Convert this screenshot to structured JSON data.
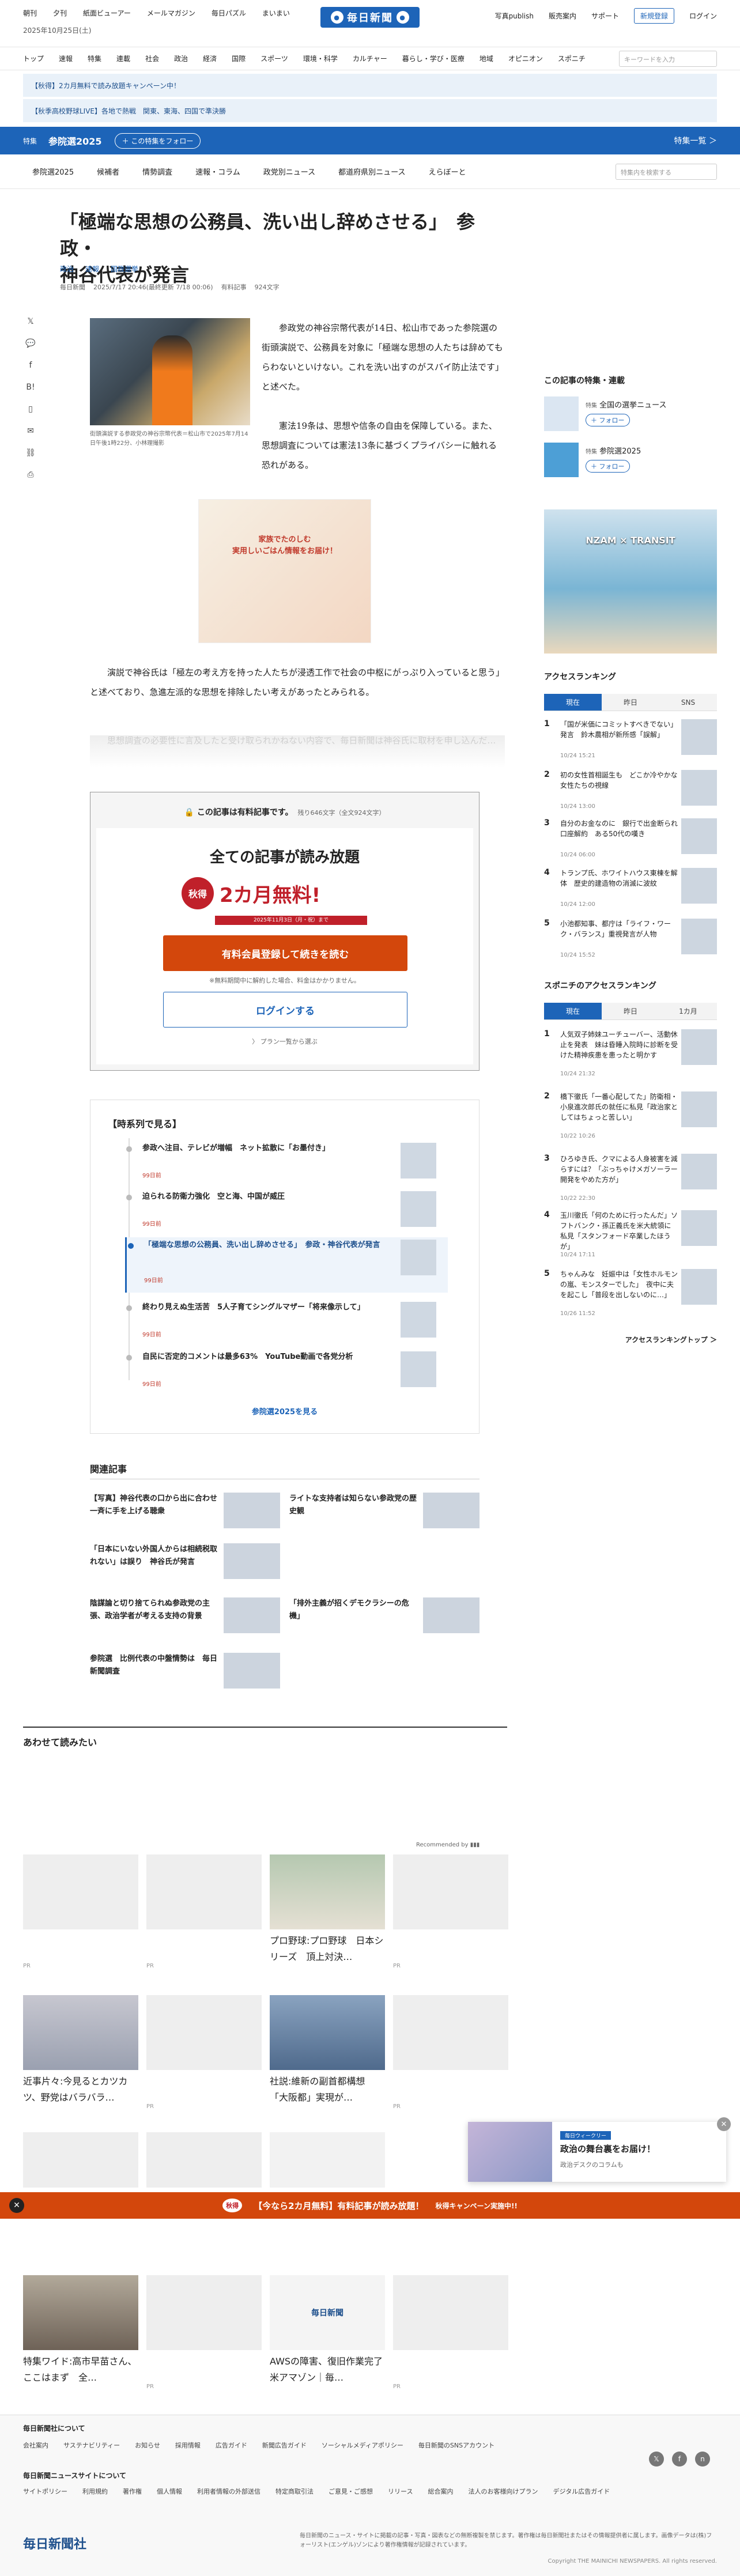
{
  "header": {
    "links": [
      "朝刊",
      "夕刊",
      "紙面ビューアー",
      "メールマガジン",
      "毎日パズル",
      "まいまい"
    ],
    "date": "2025年10月25日(土)",
    "logo": "毎日新聞",
    "right_links": [
      "写真publish",
      "販売案内",
      "サポート"
    ],
    "register_label": "新規登録",
    "login_label": "ログイン"
  },
  "catnav": {
    "items": [
      "トップ",
      "速報",
      "特集",
      "連載",
      "社会",
      "政治",
      "経済",
      "国際",
      "スポーツ",
      "環境・科学",
      "カルチャー",
      "暮らし・学び・医療",
      "地域",
      "オピニオン",
      "スポニチ"
    ],
    "search_placeholder": "キーワードを入力"
  },
  "promos": [
    "【秋得】2カ月無料で読み放題キャンペーン中！",
    "【秋季高校野球LIVE】各地で熱戦　関東、東海、四国で準決勝"
  ],
  "feature_bar": {
    "tag": "特集",
    "title": "参院選2025",
    "follow": "＋ この特集をフォロー",
    "list": "特集一覧 ＞"
  },
  "subnav": {
    "items": [
      "参院選2025",
      "候補者",
      "情勢調査",
      "速報・コラム",
      "政党別ニュース",
      "都道府県別ニュース",
      "えらぼーと"
    ],
    "search_placeholder": "特集内を検索する"
  },
  "article": {
    "title_line1": "「極端な思想の公務員、洗い出し辞めさせる」　参政・",
    "title_line2": "神谷代表が発言",
    "tags": [
      "政治",
      "速報",
      "国政選挙"
    ],
    "source": "毎日新聞",
    "datetime": "2025/7/17 20:46(最終更新 7/18 00:06)",
    "paid": "有料記事",
    "chars": "924文字",
    "caption": "街頭演説する参政党の神谷宗幣代表＝松山市で2025年7月14日午後1時22分、小林理撮影",
    "para1": "参政党の神谷宗幣代表が14日、松山市であった参院選の街頭演説で、公務員を対象に「極端な思想の人たちは辞めてもらわないといけない。これを洗い出すのがスパイ防止法です」と述べた。",
    "para2": "憲法19条は、思想や信条の自由を保障している。また、思想調査については憲法13条に基づくプライバシーに触れる恐れがある。",
    "para3": "演説で神谷氏は「極左の考え方を持った人たちが浸透工作で社会の中枢にがっぷり入っていると思う」と述べており、急進左派的な思想を排除したい考えがあったとみられる。",
    "faded": "思想調査の必要性に言及したと受け取られかねない内容で、毎日新聞は神谷氏に取材を申し込んだ…"
  },
  "ad1": {
    "line1": "家族でたのしむ",
    "line2": "実用しいごはん情報をお届け！"
  },
  "paywall": {
    "header": "この記事は有料記事です。",
    "remain": "残り646文字（全文924文字）",
    "headline": "全ての記事が読み放題",
    "badge": "秋得",
    "campaign": "2カ月無料!",
    "sub": "2025年11月3日（月・祝）まで",
    "register": "有料会員登録して続きを読む",
    "note": "※無料期間中に解約した場合、料金はかかりません。",
    "login": "ログインする",
    "plans": "〉 プラン一覧から選ぶ"
  },
  "timeline": {
    "header": "【時系列で見る】",
    "items": [
      {
        "text": "参政へ注目、テレビが増幅　ネット拡散に「お墨付き」",
        "ago": "99日前"
      },
      {
        "text": "迫られる防衛力強化　空と海、中国が威圧",
        "ago": "99日前"
      },
      {
        "text": "「極端な思想の公務員、洗い出し辞めさせる」　参政・神谷代表が発言",
        "ago": "99日前"
      },
      {
        "text": "終わり見えぬ生活苦　5人子育てシングルマザー「将来像示して」",
        "ago": "99日前"
      },
      {
        "text": "自民に否定的コメントは最多63%　YouTube動画で各党分析",
        "ago": "99日前"
      }
    ],
    "more": "参院選2025を見る"
  },
  "related": {
    "header": "関連記事",
    "items": [
      "【写真】神谷代表の口から出に合わせ一斉に手を上げる聴衆",
      "ライトな支持者は知らない参政党の歴史観",
      "「日本にいない外国人からは相続税取れない」は誤り　神谷氏が発言",
      "「排外主義が招くデモクラシーの危機」",
      "陰謀論と切り捨てられぬ参政党の主張、政治学者が考える支持の背景",
      "参院選　比例代表の中盤情勢は　毎日新聞調査"
    ]
  },
  "recommend": {
    "header": "あわせて読みたい",
    "by": "Recommended by",
    "pr": "PR",
    "cards": [
      "",
      "",
      "プロ野球:プロ野球　日本シリーズ　頂上対決…",
      "",
      "近事片々:今見るとカツカツ、野党はバラバラ…",
      "",
      "社説:維新の副首都構想　「大阪都」実現が…",
      "",
      "",
      "",
      "",
      "",
      "特集ワイド:高市早苗さん、ここはまず　全…",
      "",
      "AWSの障害、復旧作業完了　米アマゾン｜毎…",
      ""
    ]
  },
  "sidebar": {
    "feature_header": "この記事の特集・連載",
    "features": [
      {
        "tag": "特集",
        "name": "全国の選挙ニュース",
        "follow": "＋ フォロー"
      },
      {
        "tag": "特集",
        "name": "参院選2025",
        "follow": "＋ フォロー"
      }
    ],
    "ad2": "NZAM × TRANSIT",
    "ranking_header": "アクセスランキング",
    "tabs": [
      "現在",
      "昨日",
      "SNS"
    ],
    "ranking": [
      {
        "n": "1",
        "text": "「国が米価にコミットすべきでない」発言　鈴木農相が新所感「誤解」",
        "time": "10/24 15:21"
      },
      {
        "n": "2",
        "text": "初の女性首相誕生も　どこか冷やかな女性たちの視線",
        "time": "10/24 13:00"
      },
      {
        "n": "3",
        "text": "自分のお金なのに　銀行で出金断られ口座解約　ある50代の嘆き",
        "time": "10/24 06:00"
      },
      {
        "n": "4",
        "text": "トランプ氏、ホワイトハウス東棟を解体　歴史的建造物の消滅に波紋",
        "time": "10/24 12:00"
      },
      {
        "n": "5",
        "text": "小池都知事、都庁は「ライフ・ワーク・バランス」重視発言が人物",
        "time": "10/24 15:52"
      }
    ],
    "spo_header": "スポニチのアクセスランキング",
    "spo_tabs": [
      "現在",
      "昨日",
      "1カ月"
    ],
    "spo_ranking": [
      {
        "n": "1",
        "text": "人気双子姉妹ユーチューバー、活動休止を発表　妹は昏睡入院時に診断を受けた精神疾患を患ったと明かす",
        "time": "10/24 21:32"
      },
      {
        "n": "2",
        "text": "橋下徹氏「一番心配してた」防衛相・小泉進次郎氏の就任に私見「政治家としてはちょっと苦しい」",
        "time": "10/22 10:26"
      },
      {
        "n": "3",
        "text": "ひろゆき氏、クマによる人身被害を減らすには？「ぶっちゃけメガソーラー開発をやめた方が」",
        "time": "10/22 22:30"
      },
      {
        "n": "4",
        "text": "玉川徹氏「何のために行ったんだ」ソフトバンク・孫正義氏を米大統領に私見「スタンフォード卒業したほうが」",
        "time": "10/24 17:11"
      },
      {
        "n": "5",
        "text": "ちゃんみな　妊娠中は「女性ホルモンの嵐、モンスターでした」　夜中に夫を起こし「普段を出しないのに…」",
        "time": "10/26 11:52"
      }
    ],
    "ranking_more": "アクセスランキングトップ ＞"
  },
  "toast": {
    "label": "毎日ウィークリー",
    "title": "政治の舞台裏をお届け！",
    "sub": "政治デスクのコラムも"
  },
  "bottombar": {
    "badge": "秋得",
    "text": "【今なら2カ月無料】有料記事が読み放題！",
    "sub": "秋得キャンペーン実施中!!"
  },
  "footer": {
    "h1": "毎日新聞社について",
    "links1": [
      "会社案内",
      "サステナビリティー",
      "お知らせ",
      "採用情報",
      "広告ガイド",
      "新聞広告ガイド",
      "ソーシャルメディアポリシー",
      "毎日新聞のSNSアカウント"
    ],
    "h2": "毎日新聞ニュースサイトについて",
    "links2": [
      "サイトポリシー",
      "利用規約",
      "著作権",
      "個人情報",
      "利用者情報の外部送信",
      "特定商取引法",
      "ご意見・ご感想",
      "リリース",
      "総合案内",
      "法人のお客様向けプラン",
      "デジタル広告ガイド"
    ],
    "logo": "毎日新聞社",
    "copy": "毎日新聞のニュース・サイトに掲載の記事・写真・図表などの無断複製を禁じます。著作権は毎日新聞社またはその情報提供者に属します。画像データは(株)フォーリスト(エンゲル)ゾンにより著作権情報が記録されています。",
    "copyright": "Copyright THE MAINICHI NEWSPAPERS. All rights reserved."
  }
}
